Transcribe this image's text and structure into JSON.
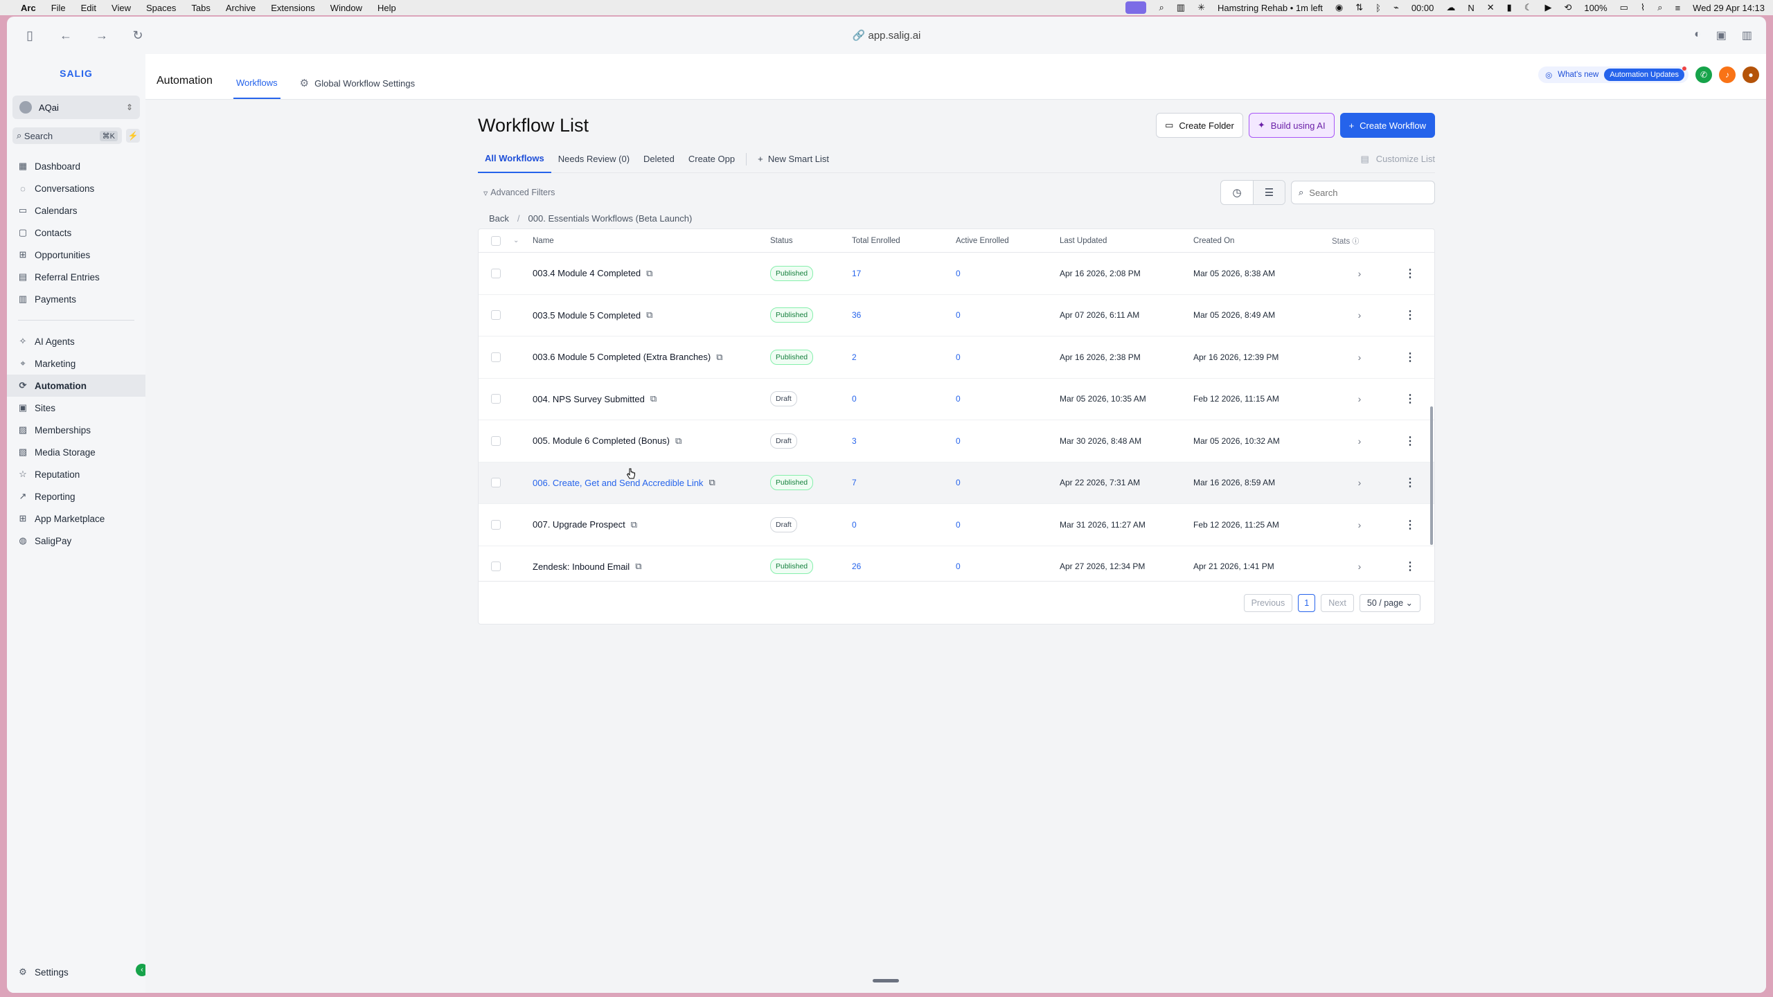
{
  "menubar": {
    "app": "Arc",
    "items": [
      "File",
      "Edit",
      "View",
      "Spaces",
      "Tabs",
      "Archive",
      "Extensions",
      "Window",
      "Help"
    ],
    "status_timer": "Hamstring Rehab • 1m left",
    "status_loop": "00:00",
    "battery": "100%",
    "clock": "Wed 29 Apr  14:13"
  },
  "browser": {
    "url": "app.salig.ai"
  },
  "sidebar": {
    "logo": "SALIG",
    "account": "AQai",
    "search_label": "Search",
    "search_shortcut": "⌘K",
    "nav_group1": [
      {
        "label": "Dashboard",
        "icon": "dashboard-icon"
      },
      {
        "label": "Conversations",
        "icon": "chat-icon"
      },
      {
        "label": "Calendars",
        "icon": "calendar-icon"
      },
      {
        "label": "Contacts",
        "icon": "contacts-icon"
      },
      {
        "label": "Opportunities",
        "icon": "opportunities-icon"
      },
      {
        "label": "Referral Entries",
        "icon": "referral-icon"
      },
      {
        "label": "Payments",
        "icon": "payments-icon"
      }
    ],
    "nav_group2": [
      {
        "label": "AI Agents",
        "icon": "ai-agents-icon"
      },
      {
        "label": "Marketing",
        "icon": "marketing-icon"
      },
      {
        "label": "Automation",
        "icon": "automation-icon",
        "active": true
      },
      {
        "label": "Sites",
        "icon": "sites-icon"
      },
      {
        "label": "Memberships",
        "icon": "memberships-icon"
      },
      {
        "label": "Media Storage",
        "icon": "media-icon"
      },
      {
        "label": "Reputation",
        "icon": "reputation-icon"
      },
      {
        "label": "Reporting",
        "icon": "reporting-icon"
      },
      {
        "label": "App Marketplace",
        "icon": "marketplace-icon"
      },
      {
        "label": "SaligPay",
        "icon": "saligpay-icon"
      }
    ],
    "settings_label": "Settings"
  },
  "topbar": {
    "section": "Automation",
    "tab_workflows": "Workflows",
    "tab_global": "Global Workflow Settings",
    "whats_new": "What's new",
    "updates_pill": "Automation Updates"
  },
  "page": {
    "title": "Workflow List",
    "btn_create_folder": "Create Folder",
    "btn_build_ai": "Build using AI",
    "btn_create_workflow": "Create Workflow",
    "tabs": [
      "All Workflows",
      "Needs Review (0)",
      "Deleted",
      "Create Opp"
    ],
    "new_smart_list": "New Smart List",
    "customize_list": "Customize List",
    "advanced_filters": "Advanced Filters",
    "search_placeholder": "Search",
    "crumb_back": "Back",
    "crumb_folder": "000. Essentials Workflows (Beta Launch)"
  },
  "table": {
    "headers": {
      "name": "Name",
      "status": "Status",
      "total": "Total Enrolled",
      "active": "Active Enrolled",
      "updated": "Last Updated",
      "created": "Created On",
      "stats": "Stats"
    },
    "rows": [
      {
        "name": "003.4 Module 4 Completed",
        "status": "Published",
        "total": "17",
        "active": "0",
        "updated": "Apr 16 2026, 2:08 PM",
        "created": "Mar 05 2026, 8:38 AM"
      },
      {
        "name": "003.5 Module 5 Completed",
        "status": "Published",
        "total": "36",
        "active": "0",
        "updated": "Apr 07 2026, 6:11 AM",
        "created": "Mar 05 2026, 8:49 AM"
      },
      {
        "name": "003.6 Module 5 Completed (Extra Branches)",
        "status": "Published",
        "total": "2",
        "active": "0",
        "updated": "Apr 16 2026, 2:38 PM",
        "created": "Apr 16 2026, 12:39 PM"
      },
      {
        "name": "004. NPS Survey Submitted",
        "status": "Draft",
        "total": "0",
        "active": "0",
        "updated": "Mar 05 2026, 10:35 AM",
        "created": "Feb 12 2026, 11:15 AM"
      },
      {
        "name": "005. Module 6 Completed (Bonus)",
        "status": "Draft",
        "total": "3",
        "active": "0",
        "updated": "Mar 30 2026, 8:48 AM",
        "created": "Mar 05 2026, 10:32 AM"
      },
      {
        "name": "006. Create, Get and Send Accredible Link",
        "status": "Published",
        "total": "7",
        "active": "0",
        "updated": "Apr 22 2026, 7:31 AM",
        "created": "Mar 16 2026, 8:59 AM"
      },
      {
        "name": "007. Upgrade Prospect",
        "status": "Draft",
        "total": "0",
        "active": "0",
        "updated": "Mar 31 2026, 11:27 AM",
        "created": "Feb 12 2026, 11:25 AM"
      },
      {
        "name": "Zendesk: Inbound Email",
        "status": "Published",
        "total": "26",
        "active": "0",
        "updated": "Apr 27 2026, 12:34 PM",
        "created": "Apr 21 2026, 1:41 PM"
      }
    ]
  },
  "pager": {
    "previous": "Previous",
    "current": "1",
    "next": "Next",
    "page_size": "50 / page"
  }
}
